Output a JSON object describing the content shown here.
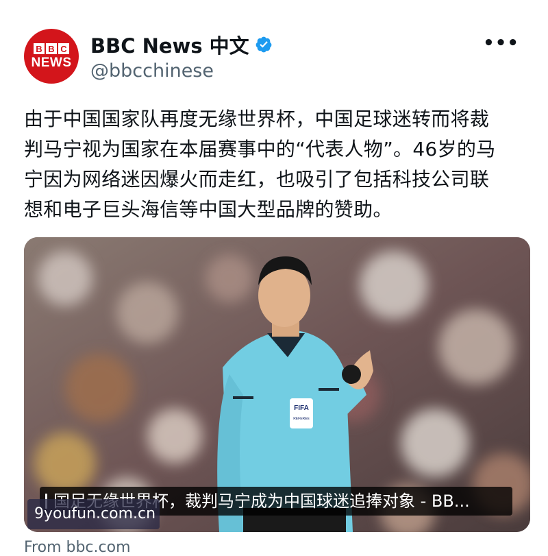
{
  "account": {
    "avatar_letters": [
      "B",
      "B",
      "C"
    ],
    "avatar_word": "NEWS",
    "display_name": "BBC News 中文",
    "handle": "@bbcchinese",
    "verified_icon": "verified-badge-icon",
    "more_label": "•••"
  },
  "tweet": {
    "text_lines": [
      "由于中国国家队再度无缘世界杯，中国足球迷转而将裁",
      "判马宁视为国家在本届赛事中的“代表人物”。46岁的马",
      "宁因为网络迷因爆火而走红，也吸引了包括科技公司联",
      "想和电子巨头海信等中国大型品牌的赞助。"
    ]
  },
  "card": {
    "headline": "国足无缘世界杯，裁判马宁成为中国球迷追捧对象 - BB...",
    "source": "From bbc.com",
    "image_badge_text": "FIFA",
    "image_badge_sub": "REFEREE"
  },
  "watermark": "9youfun.com.cn",
  "colors": {
    "brand_red": "#d3151b",
    "verified_blue": "#1d9bf0",
    "secondary_text": "#536471",
    "shirt_cyan": "#72cde2"
  }
}
